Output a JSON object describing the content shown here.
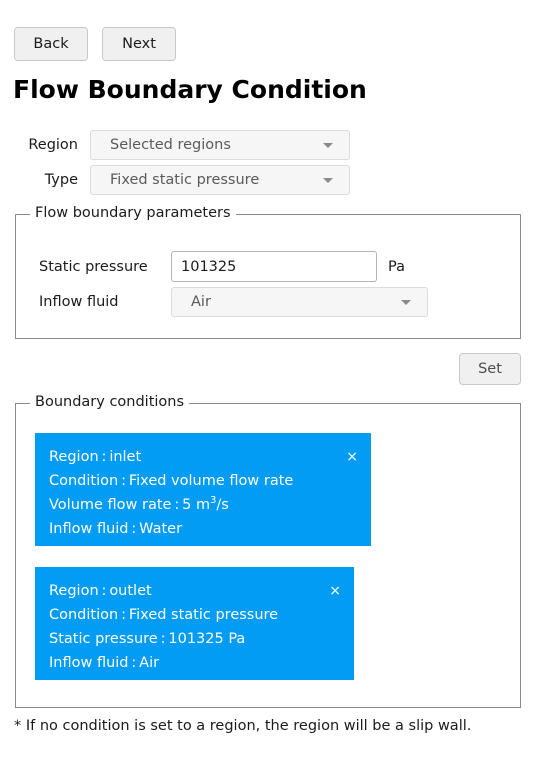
{
  "nav": {
    "back_label": "Back",
    "next_label": "Next"
  },
  "page_title": "Flow Boundary Condition",
  "form": {
    "region": {
      "label": "Region",
      "value": "Selected regions"
    },
    "type": {
      "label": "Type",
      "value": "Fixed static pressure"
    }
  },
  "parameters_group": {
    "title": "Flow boundary parameters",
    "static_pressure": {
      "label": "Static pressure",
      "value": "101325",
      "unit": "Pa"
    },
    "inflow_fluid": {
      "label": "Inflow fluid",
      "value": "Air"
    }
  },
  "set_button": {
    "label": "Set"
  },
  "boundary_conditions_group": {
    "title": "Boundary conditions",
    "close_glyph": "×",
    "cards": [
      {
        "region_line": "Region : inlet",
        "condition_line": "Condition : Fixed volume flow rate",
        "value_line_prefix": "Volume flow rate : 5 m",
        "value_line_sup": "3",
        "value_line_suffix": "/s",
        "fluid_line": "Inflow fluid : Water"
      },
      {
        "region_line": "Region : outlet",
        "condition_line": "Condition : Fixed static pressure",
        "value_line_prefix": "Static pressure : 101325 Pa",
        "value_line_sup": "",
        "value_line_suffix": "",
        "fluid_line": "Inflow fluid : Air"
      }
    ]
  },
  "footnote": "* If no condition is set to a region, the region will be a slip wall.",
  "colors": {
    "card_blue": "#029cf5",
    "button_face": "#f0f0f0",
    "combo_face": "#f6f6f6",
    "groupbox_border": "#8a8a8a"
  }
}
